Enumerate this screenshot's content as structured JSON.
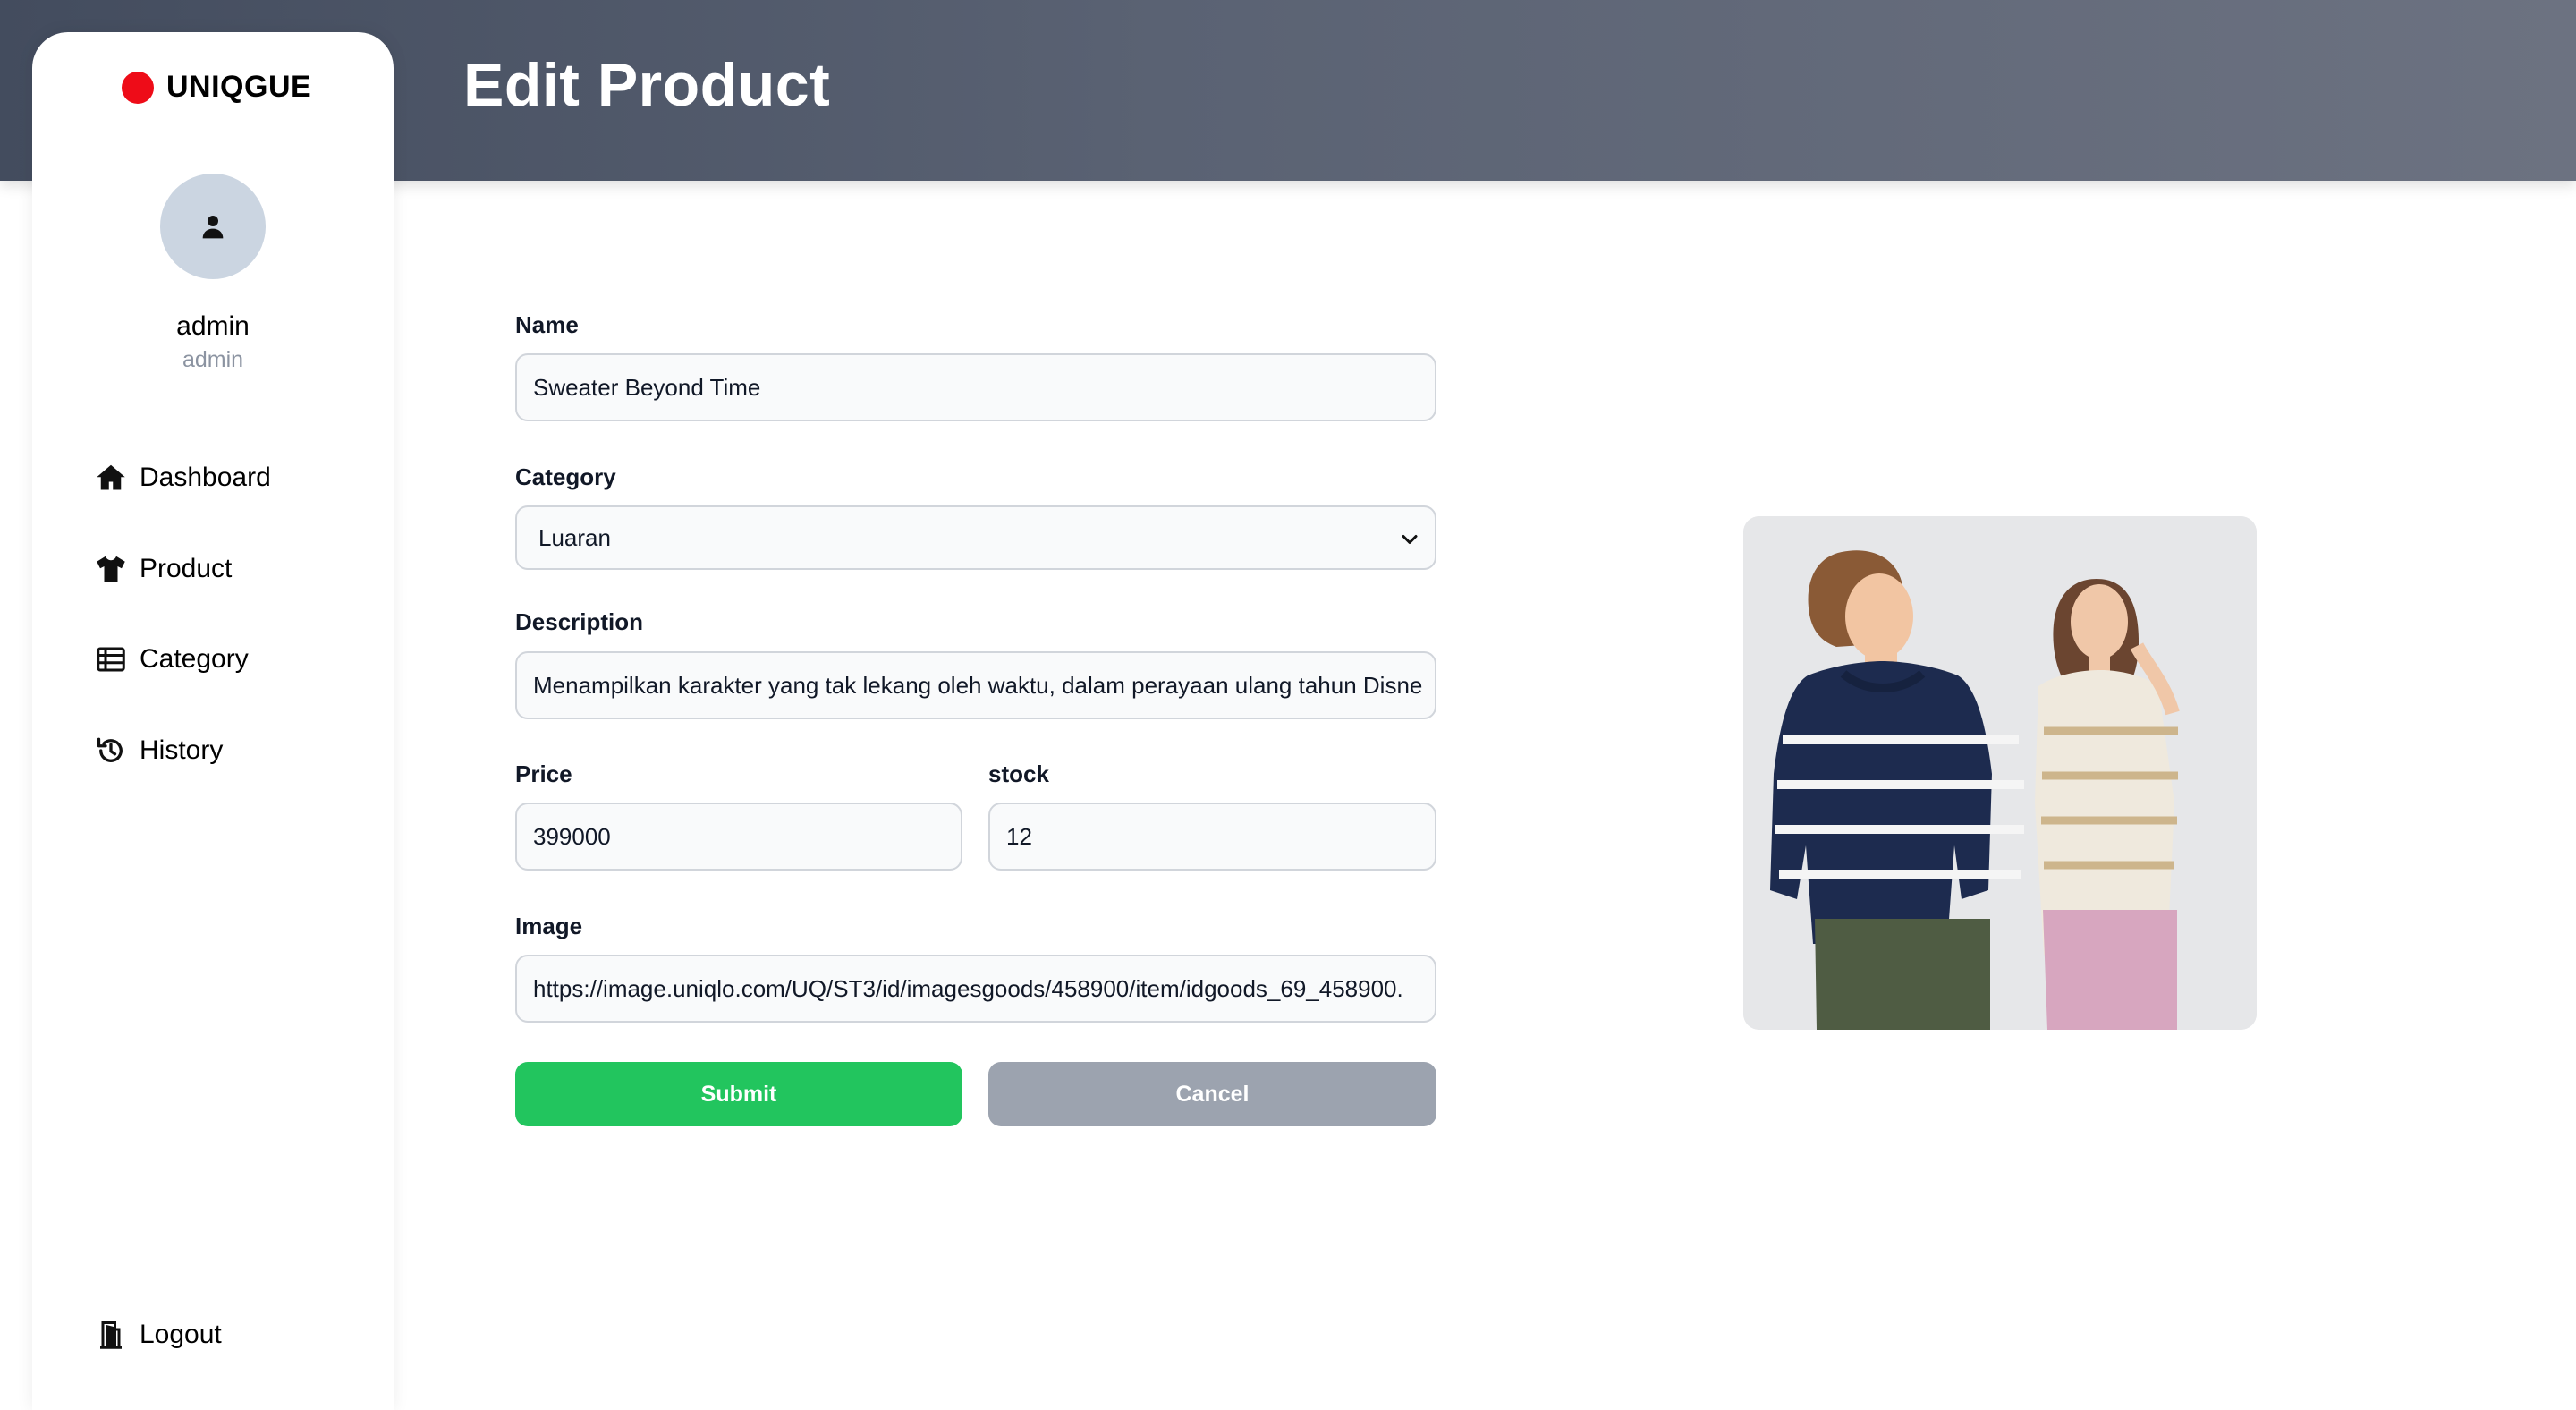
{
  "header": {
    "title": "Edit Product"
  },
  "brand": {
    "name": "UNIQGUE",
    "dot_color": "#ee0c18"
  },
  "user": {
    "name": "admin",
    "role": "admin",
    "avatar_icon": "user-icon"
  },
  "nav": {
    "items": [
      {
        "label": "Dashboard",
        "icon": "home-icon"
      },
      {
        "label": "Product",
        "icon": "shirt-icon"
      },
      {
        "label": "Category",
        "icon": "table-icon"
      },
      {
        "label": "History",
        "icon": "history-icon"
      }
    ],
    "logout": {
      "label": "Logout",
      "icon": "door-exit-icon"
    }
  },
  "form": {
    "name": {
      "label": "Name",
      "value": "Sweater Beyond Time"
    },
    "category": {
      "label": "Category",
      "value": "Luaran"
    },
    "description": {
      "label": "Description",
      "value": "Menampilkan karakter yang tak lekang oleh waktu, dalam perayaan ulang tahun Disne"
    },
    "price": {
      "label": "Price",
      "value": "399000"
    },
    "stock": {
      "label": "stock",
      "value": "12"
    },
    "image": {
      "label": "Image",
      "value": "https://image.uniqlo.com/UQ/ST3/id/imagesgoods/458900/item/idgoods_69_458900."
    },
    "submit_label": "Submit",
    "cancel_label": "Cancel"
  },
  "colors": {
    "header_gradient_start": "#434c5e",
    "header_gradient_end": "#6c7281",
    "submit": "#22c55e",
    "cancel": "#9ca3af",
    "navy_sweater": "#1d2b4f",
    "cream_sweater": "#efe9dd"
  }
}
